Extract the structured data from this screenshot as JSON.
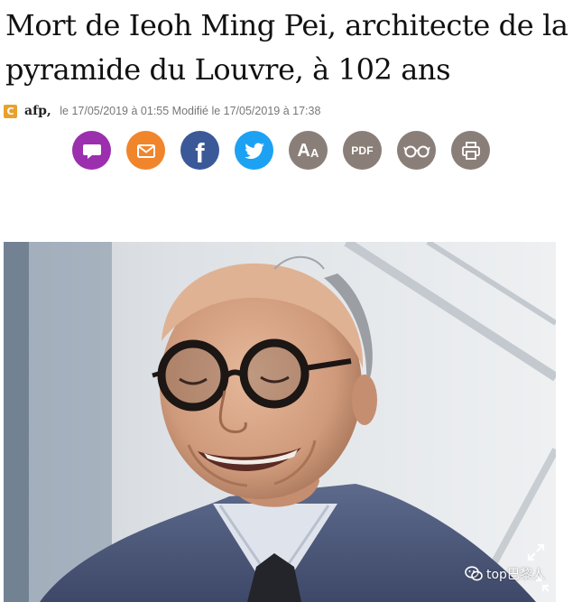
{
  "article": {
    "title": "Mort de Ieoh Ming Pei, architecte de la pyramide du Louvre, à 102 ans",
    "source": {
      "logo_letter": "C",
      "name": "afp",
      "separator": ",",
      "published_prefix": " le ",
      "published": "17/05/2019 à 01:55",
      "modified_prefix": " Modifié le ",
      "modified": "17/05/2019 à 17:38"
    }
  },
  "share": {
    "buttons": [
      {
        "name": "comment",
        "icon": "speech-bubble-icon",
        "color": "#9b2fae"
      },
      {
        "name": "email",
        "icon": "envelope-icon",
        "color": "#f0852c"
      },
      {
        "name": "facebook",
        "icon": "facebook-icon",
        "label": "f",
        "color": "#3b5998"
      },
      {
        "name": "twitter",
        "icon": "twitter-bird-icon",
        "color": "#1da1f2"
      },
      {
        "name": "font-size",
        "icon": "text-size-icon",
        "label_big": "A",
        "label_small": "A",
        "color": "#8a7f78"
      },
      {
        "name": "pdf",
        "icon": "pdf-icon",
        "label": "PDF",
        "color": "#8a7f78"
      },
      {
        "name": "reading-mode",
        "icon": "glasses-icon",
        "color": "#8a7f78"
      },
      {
        "name": "print",
        "icon": "printer-icon",
        "color": "#8a7f78"
      }
    ]
  },
  "photo": {
    "subject": "Ieoh Ming Pei portrait",
    "expand_icon": "expand-arrows-icon"
  },
  "watermark": {
    "icon": "wechat-icon",
    "text": "top巴黎人"
  }
}
